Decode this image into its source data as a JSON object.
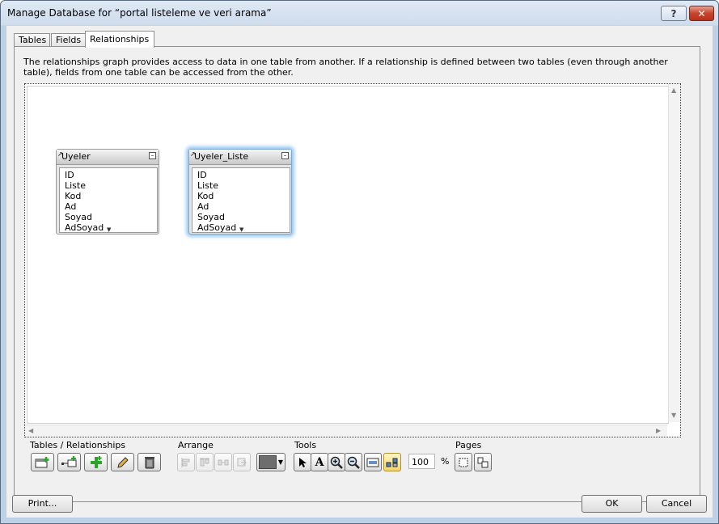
{
  "window": {
    "title": "Manage Database for “portal listeleme ve veri arama”",
    "help_label": "?",
    "close_label": "✕"
  },
  "tabs": [
    {
      "label": "Tables"
    },
    {
      "label": "Fields"
    },
    {
      "label": "Relationships"
    }
  ],
  "relationships": {
    "description": "The relationships graph provides access to data in one table from another. If a relationship is defined between two tables (even through another table), fields from one table can be accessed from the other.",
    "tables": [
      {
        "name": "Uyeler",
        "fields": [
          "ID",
          "Liste",
          "Kod",
          "Ad",
          "Soyad",
          "AdSoyad"
        ],
        "selected": false
      },
      {
        "name": "Uyeler_Liste",
        "fields": [
          "ID",
          "Liste",
          "Kod",
          "Ad",
          "Soyad",
          "AdSoyad"
        ],
        "selected": true
      }
    ]
  },
  "toolbar": {
    "tables_relationships_label": "Tables / Relationships",
    "arrange_label": "Arrange",
    "tools_label": "Tools",
    "pages_label": "Pages",
    "zoom_value": "100",
    "zoom_unit": "%",
    "color_swatch": "#6e6e6e",
    "icons": [
      "add-table-icon",
      "add-relationship-icon",
      "duplicate-icon",
      "edit-pencil-icon",
      "delete-trash-icon",
      "align-left-icon",
      "align-top-icon",
      "distribute-icon",
      "resize-icon",
      "color-swatch-icon",
      "pointer-icon",
      "text-tool-icon",
      "zoom-in-icon",
      "zoom-out-icon",
      "fit-window-icon",
      "toggle-relationships-icon",
      "page-breaks-icon",
      "page-setup-icon"
    ]
  },
  "buttons": {
    "print": "Print...",
    "ok": "OK",
    "cancel": "Cancel"
  },
  "colors": {
    "accent_glow": "#9ccaf3",
    "add_green": "#2aa52a"
  }
}
